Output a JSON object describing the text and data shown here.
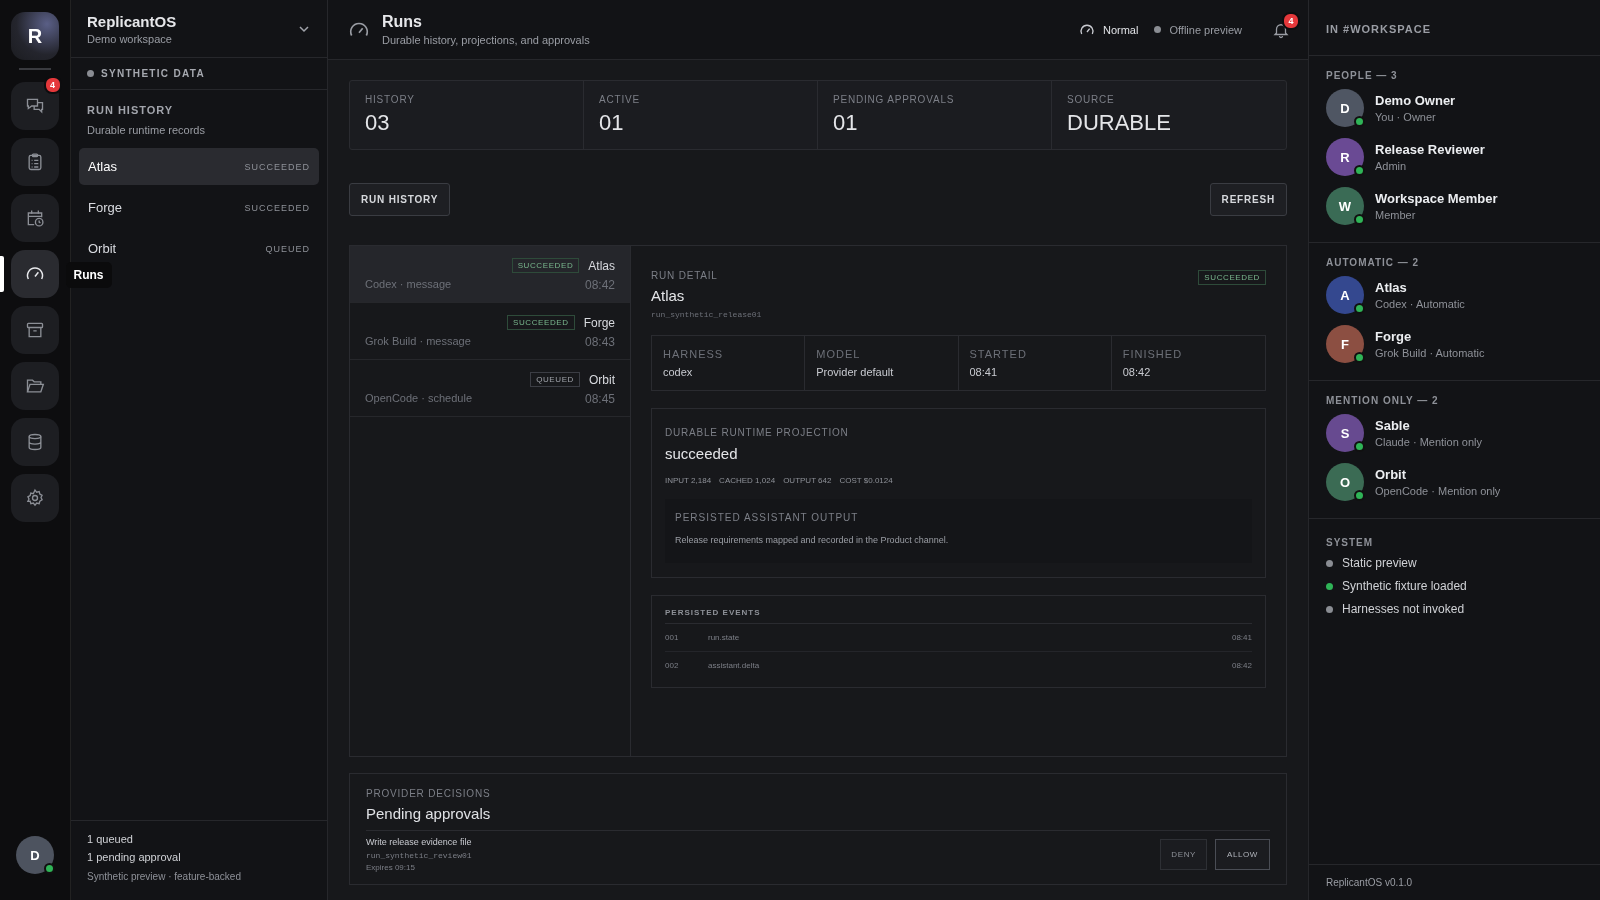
{
  "rail": {
    "logo": "R",
    "items": [
      {
        "kind": "chat",
        "selected": false,
        "badge": "4"
      },
      {
        "kind": "clipboard",
        "selected": false
      },
      {
        "kind": "calendar",
        "selected": false
      },
      {
        "kind": "gauge",
        "selected": true
      },
      {
        "kind": "archive",
        "selected": false
      },
      {
        "kind": "folder",
        "selected": false
      },
      {
        "kind": "database",
        "selected": false
      },
      {
        "kind": "settings",
        "selected": false
      }
    ],
    "tooltip": "Runs",
    "user": {
      "initial": "D",
      "online": true
    }
  },
  "workspace": {
    "name": "ReplicantOS",
    "subtitle": "Demo workspace"
  },
  "data_label": "SYNTHETIC DATA",
  "run_history": {
    "title": "RUN HISTORY",
    "subtitle": "Durable runtime records",
    "items": [
      {
        "name": "Atlas",
        "status": "SUCCEEDED",
        "selected": true
      },
      {
        "name": "Forge",
        "status": "SUCCEEDED",
        "selected": false
      },
      {
        "name": "Orbit",
        "status": "QUEUED",
        "selected": false
      }
    ]
  },
  "sidebar_footer": {
    "queued": "1 queued",
    "pending": "1 pending approval",
    "note": "Synthetic preview · feature-backed"
  },
  "header": {
    "title": "Runs",
    "subtitle": "Durable history, projections, and approvals",
    "mode": "Normal",
    "status": "Offline preview",
    "notifications": "4"
  },
  "stats": [
    {
      "label": "HISTORY",
      "value": "03"
    },
    {
      "label": "ACTIVE",
      "value": "01"
    },
    {
      "label": "PENDING APPROVALS",
      "value": "01"
    },
    {
      "label": "SOURCE",
      "value": "DURABLE"
    }
  ],
  "buttons": {
    "run_history": "RUN HISTORY",
    "refresh": "REFRESH"
  },
  "runs": [
    {
      "name": "Atlas",
      "status": "SUCCEEDED",
      "kind": "succeeded",
      "meta": "Codex · message",
      "time": "08:42",
      "selected": true
    },
    {
      "name": "Forge",
      "status": "SUCCEEDED",
      "kind": "succeeded",
      "meta": "Grok Build · message",
      "time": "08:43",
      "selected": false
    },
    {
      "name": "Orbit",
      "status": "QUEUED",
      "kind": "queued",
      "meta": "OpenCode · schedule",
      "time": "08:45",
      "selected": false
    }
  ],
  "detail": {
    "label": "RUN DETAIL",
    "title": "Atlas",
    "status": "SUCCEEDED",
    "kind": "succeeded",
    "run_id": "run_synthetic_release01",
    "fields": [
      {
        "label": "HARNESS",
        "value": "codex"
      },
      {
        "label": "MODEL",
        "value": "Provider default"
      },
      {
        "label": "STARTED",
        "value": "08:41"
      },
      {
        "label": "FINISHED",
        "value": "08:42"
      }
    ],
    "projection": {
      "label": "DURABLE RUNTIME PROJECTION",
      "state": "succeeded",
      "metrics": [
        "INPUT 2,184",
        "CACHED 1,024",
        "OUTPUT 642",
        "COST $0.0124"
      ],
      "output": {
        "title": "PERSISTED ASSISTANT OUTPUT",
        "text": "Release requirements mapped and recorded in the Product channel."
      }
    },
    "events": {
      "title": "PERSISTED EVENTS",
      "rows": [
        {
          "seq": "001",
          "name": "run.state",
          "time": "08:41"
        },
        {
          "seq": "002",
          "name": "assistant.delta",
          "time": "08:42"
        }
      ]
    }
  },
  "approvals": {
    "label": "PROVIDER DECISIONS",
    "title": "Pending approvals",
    "items": [
      {
        "title": "Write release evidence file",
        "run_id": "run_synthetic_review01",
        "expires": "Expires 09:15",
        "deny": "DENY",
        "allow": "ALLOW"
      }
    ]
  },
  "members": {
    "title": "IN #WORKSPACE",
    "groups": [
      {
        "title": "PEOPLE — 3",
        "members": [
          {
            "initial": "D",
            "name": "Demo Owner",
            "role": "You · Owner",
            "color": "#4f5663",
            "online": true
          },
          {
            "initial": "R",
            "name": "Release Reviewer",
            "role": "Admin",
            "color": "#6a4a94",
            "online": true
          },
          {
            "initial": "W",
            "name": "Workspace Member",
            "role": "Member",
            "color": "#3a6b55",
            "online": true
          }
        ]
      },
      {
        "title": "AUTOMATIC — 2",
        "members": [
          {
            "initial": "A",
            "name": "Atlas",
            "role": "Codex · Automatic",
            "color": "#34488f",
            "online": true
          },
          {
            "initial": "F",
            "name": "Forge",
            "role": "Grok Build · Automatic",
            "color": "#8c4f42",
            "online": true
          }
        ]
      },
      {
        "title": "MENTION ONLY — 2",
        "members": [
          {
            "initial": "S",
            "name": "Sable",
            "role": "Claude · Mention only",
            "color": "#674a90",
            "online": true
          },
          {
            "initial": "O",
            "name": "Orbit",
            "role": "OpenCode · Mention only",
            "color": "#3b6b54",
            "online": true
          }
        ]
      }
    ],
    "system": {
      "title": "SYSTEM",
      "items": [
        {
          "text": "Static preview",
          "color": "#8a8d93"
        },
        {
          "text": "Synthetic fixture loaded",
          "color": "#2fb457"
        },
        {
          "text": "Harnesses not invoked",
          "color": "#8a8d93"
        }
      ]
    },
    "version": "ReplicantOS v0.1.0"
  }
}
